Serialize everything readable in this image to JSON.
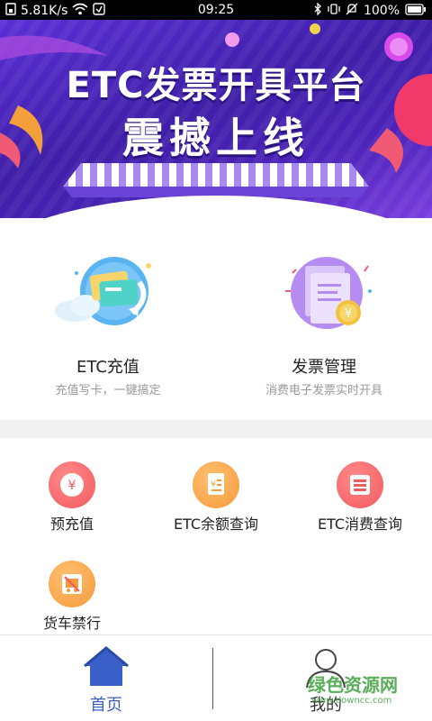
{
  "status_bar": {
    "network_speed": "5.81K/s",
    "time": "09:25",
    "battery": "100%"
  },
  "banner": {
    "title_line1": "ETC发票开具平台",
    "title_line2": "震撼上线"
  },
  "main_cards": [
    {
      "title": "ETC充值",
      "subtitle": "充值写卡，一键搞定"
    },
    {
      "title": "发票管理",
      "subtitle": "消费电子发票实时开具"
    }
  ],
  "grid_items": [
    {
      "label": "预充值",
      "icon": "yen-icon",
      "color": "#f25a5e"
    },
    {
      "label": "ETC余额查询",
      "icon": "balance-doc-icon",
      "color": "#f59a3a"
    },
    {
      "label": "ETC消费查询",
      "icon": "list-icon",
      "color": "#f25a5e"
    },
    {
      "label": "货车禁行",
      "icon": "truck-ban-icon",
      "color": "#f59a3a"
    }
  ],
  "bottom_nav": {
    "home_label": "首页",
    "mine_label": "我的",
    "active_color": "#3a5fc8"
  },
  "watermark": {
    "text": "绿色资源网",
    "url": "www.downcc.com"
  }
}
